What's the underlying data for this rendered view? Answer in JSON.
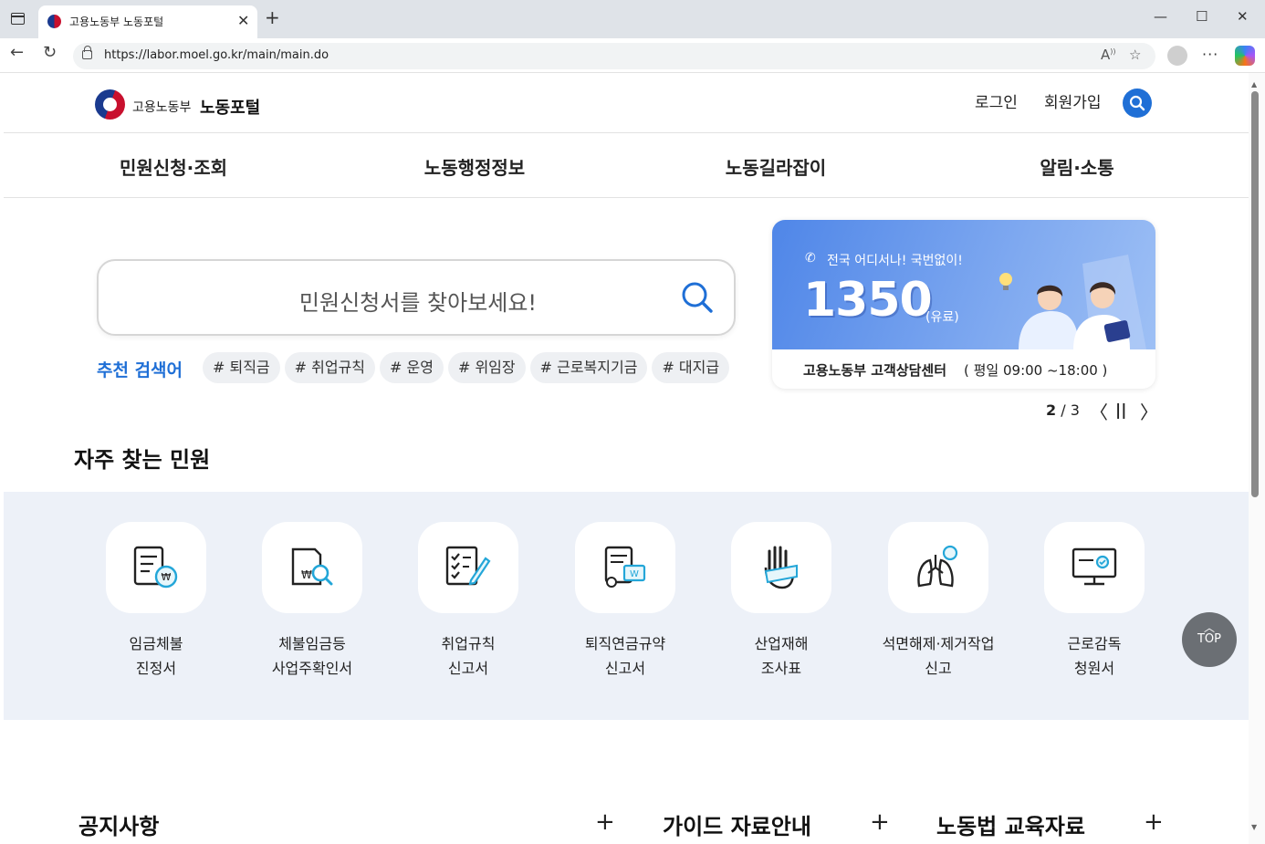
{
  "browser": {
    "tab_title": "고용노동부 노동포털",
    "tab_close": "✕",
    "new_tab": "+",
    "url": "https://labor.moel.go.kr/main/main.do",
    "minimize": "—",
    "maximize": "☐",
    "close": "✕",
    "back": "←",
    "reload": "↻",
    "menu": "···"
  },
  "header": {
    "logo_ministry": "고용노동부",
    "logo_portal": "노동포털",
    "login": "로그인",
    "signup": "회원가입"
  },
  "gnb": [
    "민원신청·조회",
    "노동행정정보",
    "노동길라잡이",
    "알림·소통"
  ],
  "search": {
    "placeholder": "민원신청서를 찾아보세요!",
    "reco_label": "추천 검색어",
    "tags": [
      "# 퇴직금",
      "# 취업규칙",
      "# 운영",
      "# 위임장",
      "# 근로복지기금",
      "# 대지급"
    ]
  },
  "banner": {
    "tagline": "전국 어디서나! 국번없이!",
    "number": "1350",
    "paid": "(유료)",
    "center": "고용노동부 고객상담센터",
    "hours": "( 평일 09:00 ~18:00 )"
  },
  "pager": {
    "current": "2",
    "total": "/ 3",
    "prev": "〈",
    "pause": "||",
    "next": "〉"
  },
  "frequent": {
    "title": "자주 찾는 민원",
    "items": [
      {
        "label": "임금체불\n진정서"
      },
      {
        "label": "체불임금등\n사업주확인서"
      },
      {
        "label": "취업규칙\n신고서"
      },
      {
        "label": "퇴직연금규약\n신고서"
      },
      {
        "label": "산업재해\n조사표"
      },
      {
        "label": "석면해제·제거작업\n신고"
      },
      {
        "label": "근로감독\n청원서"
      }
    ]
  },
  "top_button": {
    "label": "TOP",
    "arrow": "︿"
  },
  "boards": [
    {
      "title": "공지사항",
      "plus": "+"
    },
    {
      "title": "가이드 자료안내",
      "plus": "+"
    },
    {
      "title": "노동법 교육자료",
      "plus": "+"
    }
  ],
  "colors": {
    "accent": "#1f6fd6",
    "band": "#edf1f8",
    "banner": "#5b8ee9"
  }
}
